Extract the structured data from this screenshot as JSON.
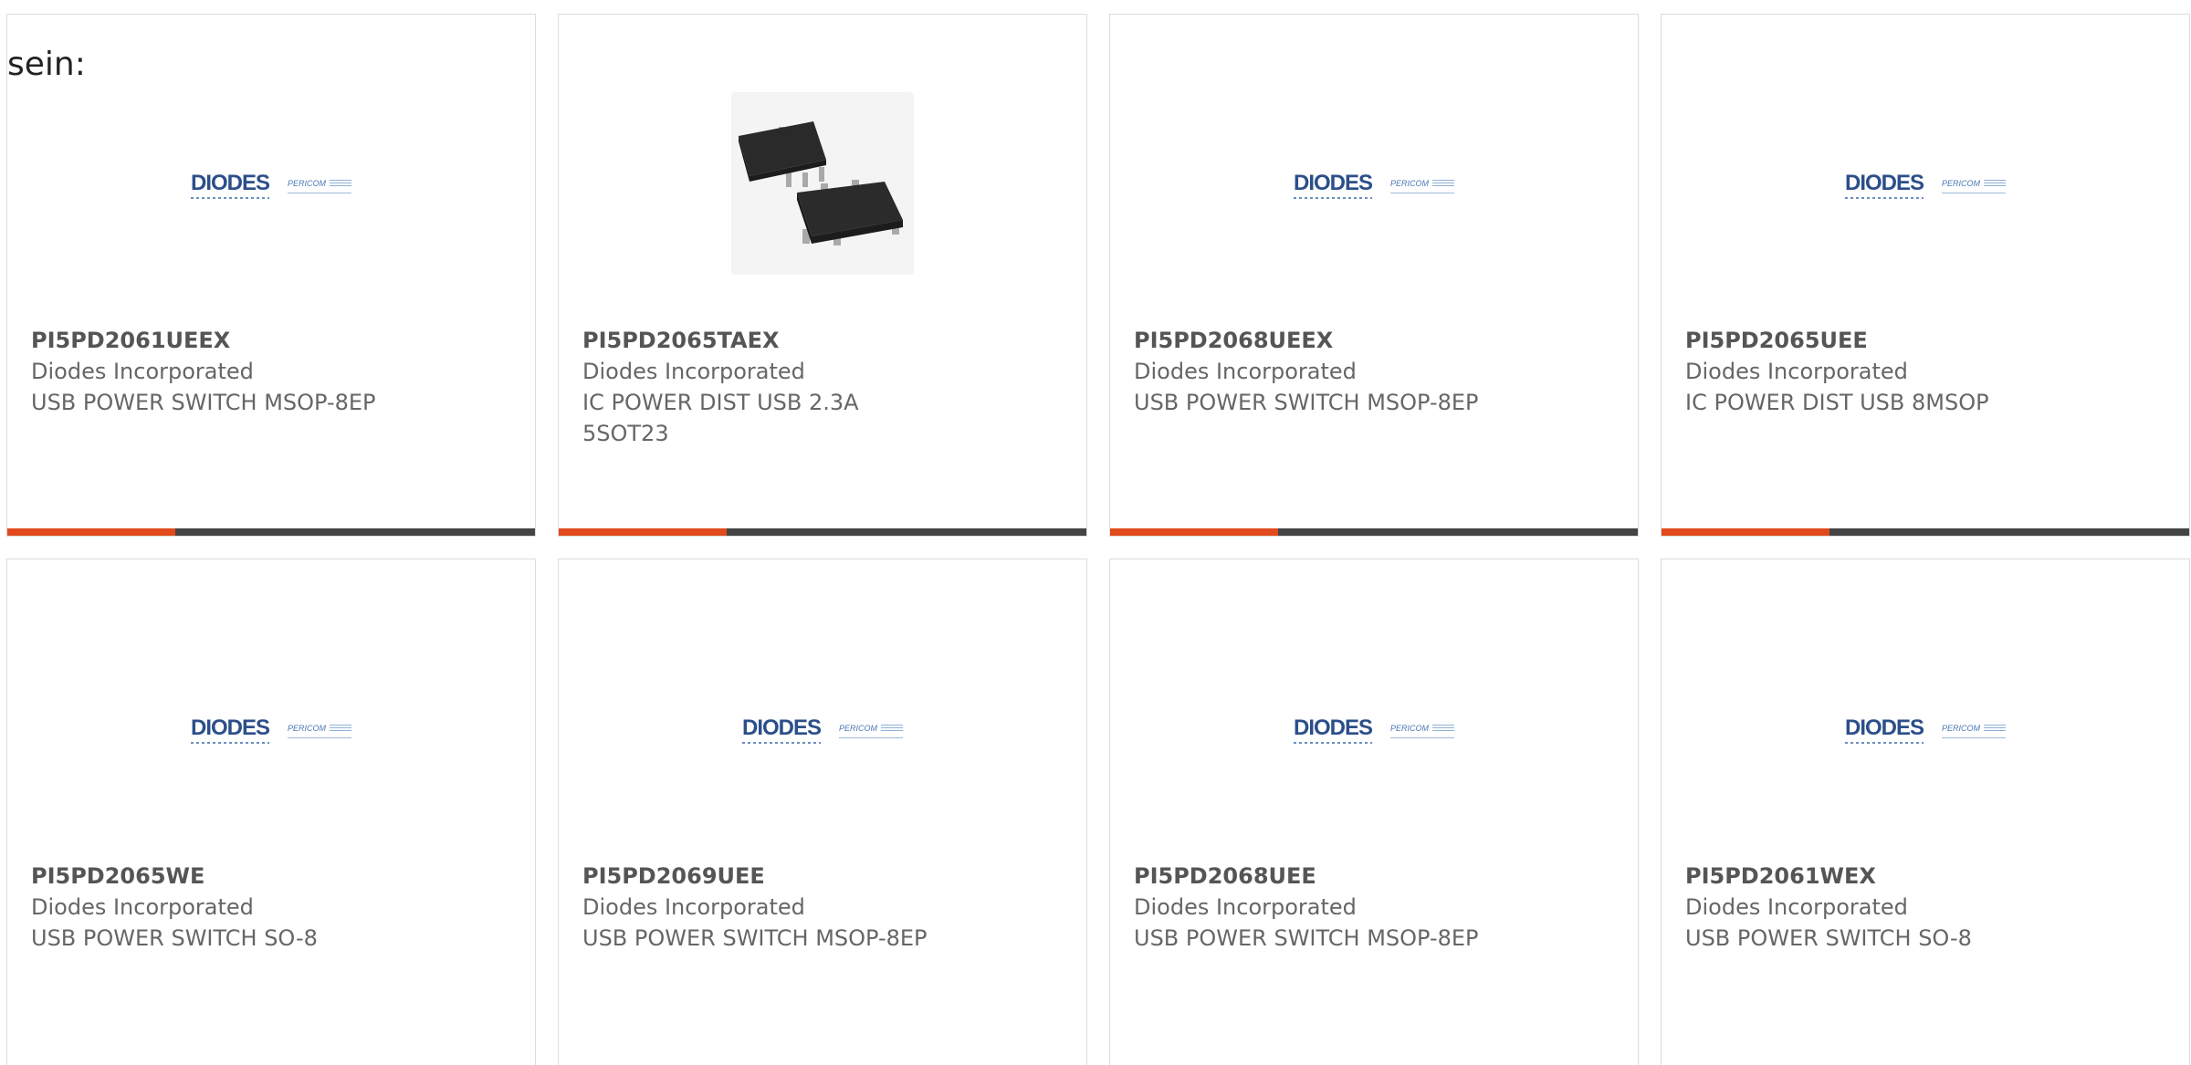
{
  "intro_text": "sein:",
  "products": [
    {
      "part_number": "PI5PD2061UEEX",
      "manufacturer": "Diodes Incorporated",
      "description": "USB POWER SWITCH MSOP-8EP",
      "image": "diodes-pericom-logo"
    },
    {
      "part_number": "PI5PD2065TAEX",
      "manufacturer": "Diodes Incorporated",
      "description": "IC POWER DIST USB 2.3A 5SOT23",
      "image": "sot23-package-photo"
    },
    {
      "part_number": "PI5PD2068UEEX",
      "manufacturer": "Diodes Incorporated",
      "description": "USB POWER SWITCH MSOP-8EP",
      "image": "diodes-pericom-logo"
    },
    {
      "part_number": "PI5PD2065UEE",
      "manufacturer": "Diodes Incorporated",
      "description": "IC POWER DIST USB 8MSOP",
      "image": "diodes-pericom-logo"
    },
    {
      "part_number": "PI5PD2065WE",
      "manufacturer": "Diodes Incorporated",
      "description": "USB POWER SWITCH SO-8",
      "image": "diodes-pericom-logo"
    },
    {
      "part_number": "PI5PD2069UEE",
      "manufacturer": "Diodes Incorporated",
      "description": "USB POWER SWITCH MSOP-8EP",
      "image": "diodes-pericom-logo"
    },
    {
      "part_number": "PI5PD2068UEE",
      "manufacturer": "Diodes Incorporated",
      "description": "USB POWER SWITCH MSOP-8EP",
      "image": "diodes-pericom-logo"
    },
    {
      "part_number": "PI5PD2061WEX",
      "manufacturer": "Diodes Incorporated",
      "description": "USB POWER SWITCH SO-8",
      "image": "diodes-pericom-logo"
    }
  ],
  "logo": {
    "brand": "DIODES",
    "sub_brand": "PERICOM"
  },
  "colors": {
    "accent": "#e04a1c",
    "bar": "#444444",
    "text": "#666666",
    "border": "#dcdcdc"
  }
}
